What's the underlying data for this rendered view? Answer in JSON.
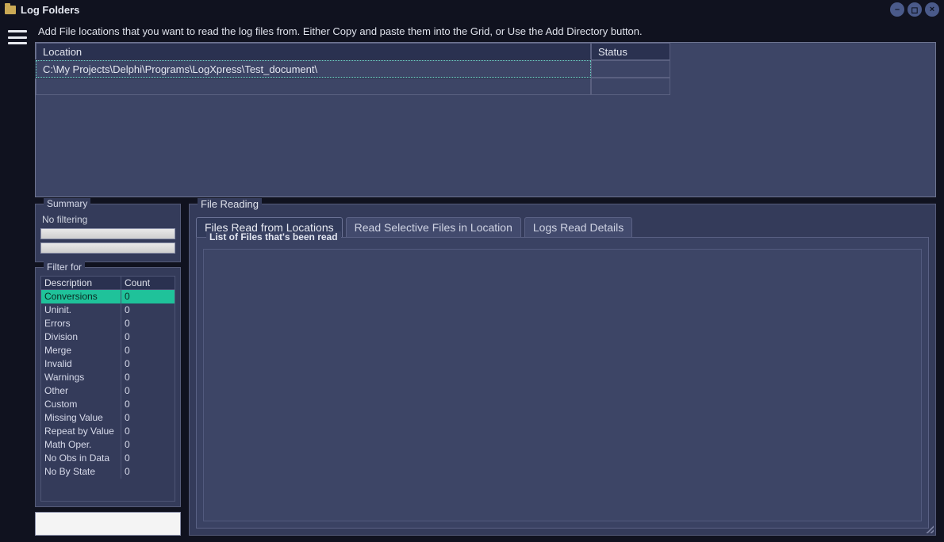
{
  "window": {
    "title": "Log Folders"
  },
  "instruction": "Add File locations that you want to read the log files from. Either Copy and paste them  into the Grid, or Use the Add Directory button.",
  "locations": {
    "headers": {
      "location": "Location",
      "status": "Status"
    },
    "rows": [
      {
        "location": "C:\\My Projects\\Delphi\\Programs\\LogXpress\\Test_document\\",
        "status": ""
      }
    ]
  },
  "summary": {
    "title": "Summary",
    "no_filtering": "No filtering",
    "bar1": "",
    "bar2": ""
  },
  "filter": {
    "title": "Filter for",
    "headers": {
      "description": "Description",
      "count": "Count"
    },
    "rows": [
      {
        "description": "Conversions",
        "count": "0",
        "selected": true
      },
      {
        "description": "Uninit.",
        "count": "0"
      },
      {
        "description": "Errors",
        "count": "0"
      },
      {
        "description": "Division",
        "count": "0"
      },
      {
        "description": "Merge",
        "count": "0"
      },
      {
        "description": "Invalid",
        "count": "0"
      },
      {
        "description": "Warnings",
        "count": "0"
      },
      {
        "description": "Other",
        "count": "0"
      },
      {
        "description": "Custom",
        "count": "0"
      },
      {
        "description": "Missing Value",
        "count": "0"
      },
      {
        "description": "Repeat by Value",
        "count": "0"
      },
      {
        "description": "Math Oper.",
        "count": "0"
      },
      {
        "description": "No Obs in Data",
        "count": "0"
      },
      {
        "description": "No By State",
        "count": "0"
      }
    ]
  },
  "file_reading": {
    "title": "File Reading",
    "tabs": [
      {
        "label": "Files Read from Locations",
        "active": true
      },
      {
        "label": "Read Selective Files in Location",
        "active": false
      },
      {
        "label": "Logs Read Details",
        "active": false
      }
    ],
    "list_title": "List of Files that's been read"
  }
}
